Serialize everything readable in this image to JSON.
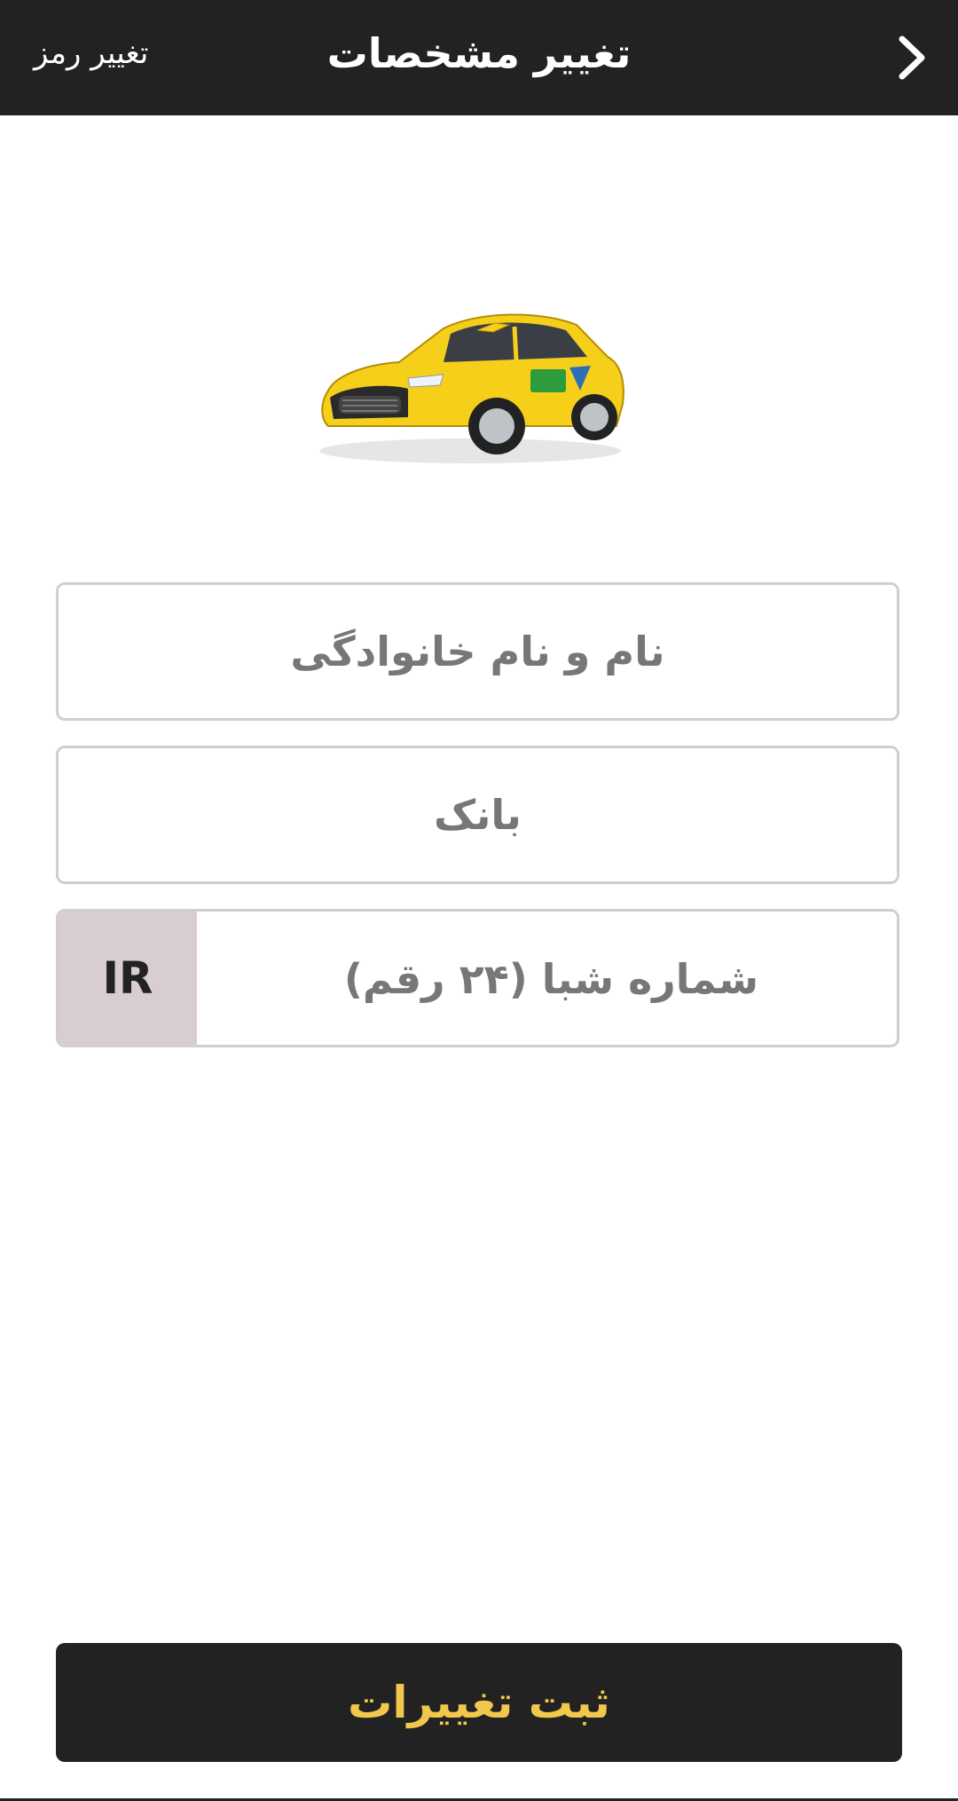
{
  "header": {
    "title": "تغییر مشخصات",
    "change_password_label": "تغییر رمز",
    "back_icon": "chevron-right-icon"
  },
  "form": {
    "name_placeholder": "نام و نام خانوادگی",
    "bank_placeholder": "بانک",
    "sheba_placeholder": "شماره شبا (۲۴ رقم)",
    "sheba_prefix": "IR"
  },
  "submit_label": "ثبت تغییرات",
  "colors": {
    "header_bg": "#222222",
    "accent": "#f1c84b",
    "prefix_bg": "#d8cdd0"
  }
}
